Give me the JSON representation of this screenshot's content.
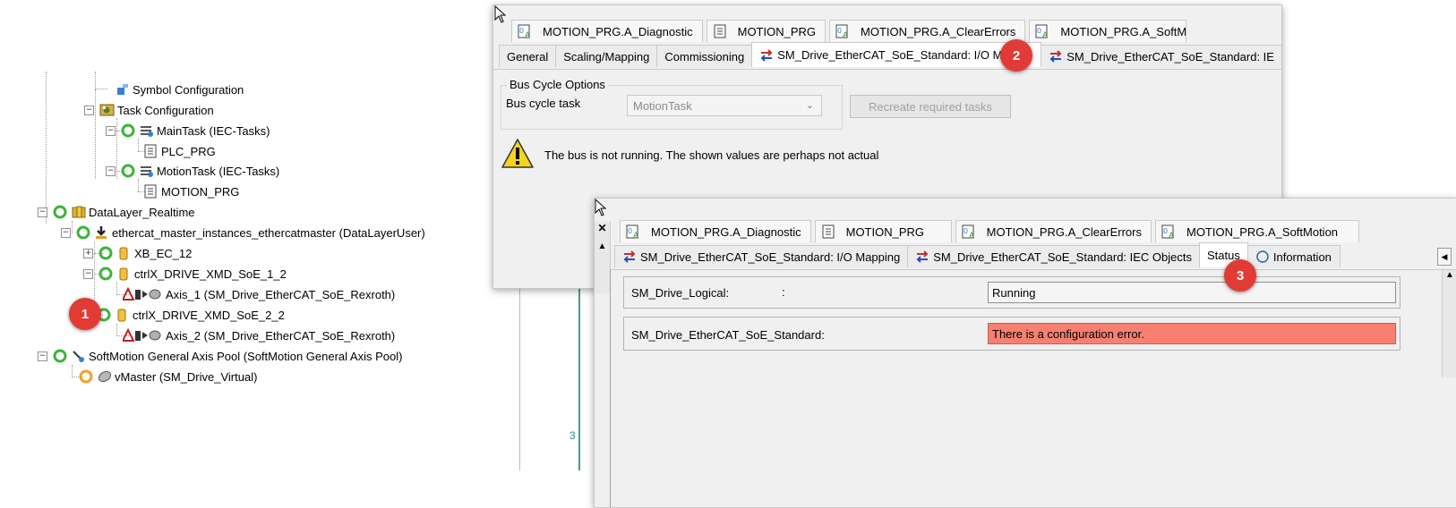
{
  "tree": {
    "items": [
      {
        "label": "Symbol Configuration",
        "icon": "symbol-config-icon"
      },
      {
        "label": "Task Configuration",
        "icon": "task-config-icon"
      },
      {
        "label": "MainTask (IEC-Tasks)",
        "icon": "task-icon"
      },
      {
        "label": "PLC_PRG",
        "icon": "program-icon"
      },
      {
        "label": "MotionTask (IEC-Tasks)",
        "icon": "task-icon"
      },
      {
        "label": "MOTION_PRG",
        "icon": "program-icon"
      },
      {
        "label": "DataLayer_Realtime",
        "icon": "datalayer-icon"
      },
      {
        "label": "ethercat_master_instances_ethercatmaster (DataLayerUser)",
        "icon": "ethercat-master-icon"
      },
      {
        "label": "XB_EC_12",
        "icon": "device-icon"
      },
      {
        "label": "ctrlX_DRIVE_XMD_SoE_1_2",
        "icon": "device-icon"
      },
      {
        "label": "Axis_1 (SM_Drive_EtherCAT_SoE_Rexroth)",
        "icon": "axis-icon"
      },
      {
        "label": "ctrlX_DRIVE_XMD_SoE_2_2",
        "icon": "device-icon"
      },
      {
        "label": "Axis_2 (SM_Drive_EtherCAT_SoE_Rexroth)",
        "icon": "axis-icon"
      },
      {
        "label": "SoftMotion General Axis Pool (SoftMotion General Axis Pool)",
        "icon": "axis-pool-icon"
      },
      {
        "label": "vMaster (SM_Drive_Virtual)",
        "icon": "virtual-axis-icon"
      }
    ],
    "line_number": "3"
  },
  "badges": {
    "one": "1",
    "two": "2",
    "three": "3"
  },
  "window1": {
    "doc_tabs": [
      "MOTION_PRG.A_Diagnostic",
      "MOTION_PRG",
      "MOTION_PRG.A_ClearErrors",
      "MOTION_PRG.A_SoftMo"
    ],
    "sub_tabs": [
      "General",
      "Scaling/Mapping",
      "Commissioning",
      "SM_Drive_EtherCAT_SoE_Standard: I/O Ma",
      "SM_Drive_EtherCAT_SoE_Standard: IE"
    ],
    "bus_cycle_group": "Bus Cycle Options",
    "bus_cycle_label": "Bus cycle task",
    "bus_cycle_value": "MotionTask",
    "recreate_button": "Recreate required tasks",
    "warning_text": "The bus is not running. The shown values are perhaps not actual"
  },
  "window2": {
    "doc_tabs": [
      "MOTION_PRG.A_Diagnostic",
      "MOTION_PRG",
      "MOTION_PRG.A_ClearErrors",
      "MOTION_PRG.A_SoftMotion"
    ],
    "sub_tabs": [
      "SM_Drive_EtherCAT_SoE_Standard: I/O Mapping",
      "SM_Drive_EtherCAT_SoE_Standard: IEC Objects",
      "Status",
      "Information"
    ],
    "rows": [
      {
        "label": "SM_Drive_Logical:",
        "colon": ":",
        "value": "Running"
      },
      {
        "label": "SM_Drive_EtherCAT_SoE_Standard:",
        "value": "There is a configuration error."
      }
    ]
  },
  "colors": {
    "badge": "#e23b35",
    "error_bg": "#f88070",
    "icon_green": "#3cb43c",
    "icon_orange": "#f0a030"
  }
}
